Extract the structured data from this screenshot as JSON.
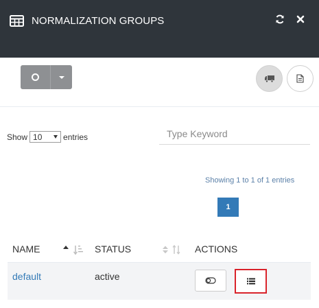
{
  "header": {
    "title": "NORMALIZATION GROUPS",
    "icon": "table-grid-icon",
    "actions": [
      "refresh-icon",
      "close-icon"
    ]
  },
  "toolbar": {
    "split_button_icon": "circle-icon",
    "dropdown_icon": "caret-down-icon",
    "right_buttons": [
      "truck-icon",
      "document-icon"
    ]
  },
  "entries": {
    "show_label": "Show",
    "page_size": "10",
    "entries_label": "entries"
  },
  "search": {
    "placeholder": "Type Keyword",
    "value": ""
  },
  "pagination": {
    "info": "Showing 1 to 1 of 1 entries",
    "current_page": "1"
  },
  "table": {
    "columns": [
      "NAME",
      "STATUS",
      "ACTIONS"
    ],
    "rows": [
      {
        "name": "default",
        "status": "active",
        "actions": [
          "toggle-icon",
          "list-icon"
        ]
      }
    ]
  },
  "colors": {
    "header_bg": "#2f353b",
    "primary": "#337ab7",
    "highlight_border": "#d9222a",
    "button_grey": "#8e9093",
    "row_bg": "#f3f4f6"
  }
}
